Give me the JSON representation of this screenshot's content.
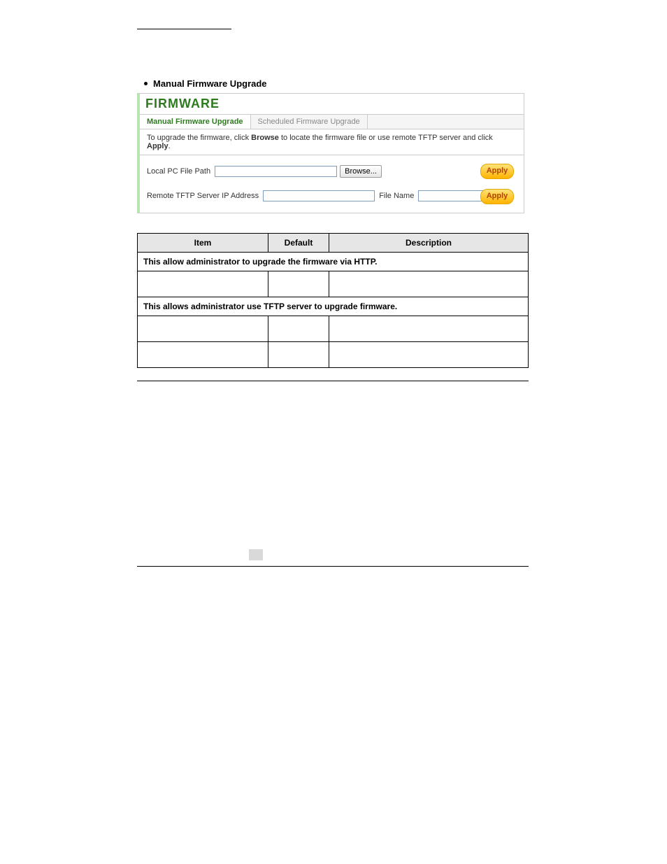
{
  "heading": {
    "bullet_title": "Manual Firmware Upgrade"
  },
  "panel": {
    "title": "FIRMWARE",
    "tabs": [
      {
        "label": "Manual Firmware Upgrade",
        "active": true
      },
      {
        "label": "Scheduled Firmware Upgrade",
        "active": false
      }
    ],
    "instruction_prefix": "To upgrade the firmware, click ",
    "instruction_browse": "Browse",
    "instruction_mid": " to locate the firmware file or use remote TFTP server and click ",
    "instruction_apply": "Apply",
    "row1": {
      "label": "Local PC File Path",
      "browse_label": "Browse...",
      "apply_label": "Apply"
    },
    "row2": {
      "label_ip": "Remote TFTP Server IP Address",
      "label_file": "File Name",
      "apply_label": "Apply"
    }
  },
  "table": {
    "headers": {
      "item": "Item",
      "default": "Default",
      "description": "Description"
    },
    "section1": "This allow administrator to upgrade the firmware via HTTP.",
    "section2": "This allows administrator use TFTP server to upgrade firmware."
  }
}
